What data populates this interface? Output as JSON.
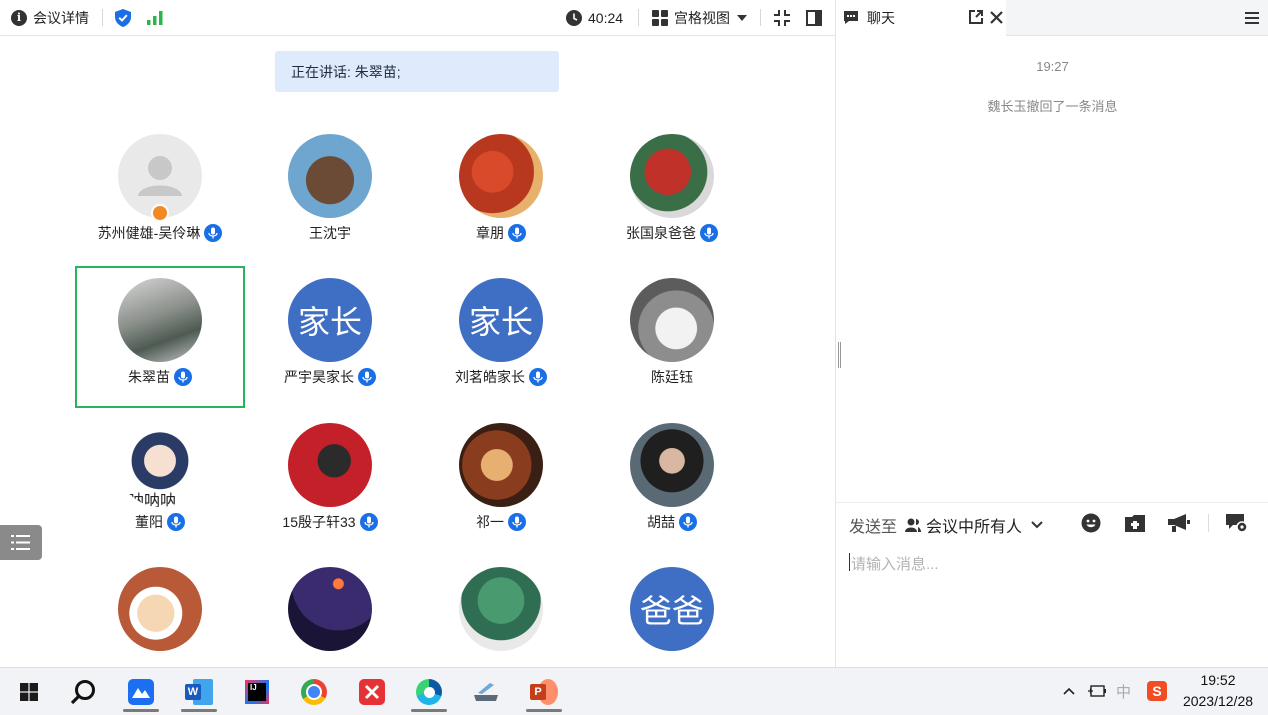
{
  "topbar": {
    "info_label": "会议详情",
    "timer": "40:24",
    "view_label": "宫格视图"
  },
  "speaking": {
    "text": "正在讲话: 朱翠苗;"
  },
  "participants": [
    {
      "name": "苏州健雄-吴伶琳"
    },
    {
      "name": "王沈宇"
    },
    {
      "name": "章朋"
    },
    {
      "name": "张国泉爸爸"
    },
    {
      "name": "朱翠苗"
    },
    {
      "name": "严宇昊家长",
      "avatar_text": "家长"
    },
    {
      "name": "刘茗皓家长",
      "avatar_text": "家长"
    },
    {
      "name": "陈廷钰"
    },
    {
      "name": "董阳",
      "avatar_text": "呐呐呐"
    },
    {
      "name": "15殷子轩33"
    },
    {
      "name": "祁一"
    },
    {
      "name": "胡喆"
    },
    {
      "name": ""
    },
    {
      "name": ""
    },
    {
      "name": ""
    },
    {
      "name": "",
      "avatar_text": "爸爸"
    }
  ],
  "chat": {
    "title": "聊天",
    "time": "19:27",
    "system_msg": "魏长玉撤回了一条消息",
    "send_to_label": "发送至",
    "recipient": "会议中所有人",
    "placeholder": "请输入消息..."
  },
  "taskbar": {
    "ime": "中",
    "time": "19:52",
    "date": "2023/12/28"
  },
  "colors": {
    "accent_blue": "#1a6fe6",
    "speaking_bg": "#dfeafc",
    "selected_border": "#27b45a",
    "family_avatar": "#3f6fc4"
  }
}
